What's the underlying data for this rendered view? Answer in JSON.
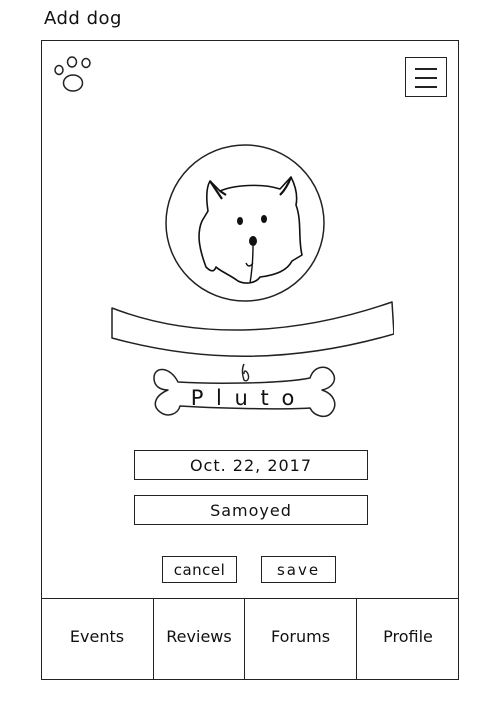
{
  "screen": {
    "title": "Add dog"
  },
  "header": {
    "logo_icon": "paw-print-icon",
    "menu_icon": "hamburger-menu-icon"
  },
  "profile": {
    "photo_icon": "dog-face-icon",
    "name": "Pluto",
    "name_display": "P l u t o",
    "birthdate": "Oct. 22, 2017",
    "breed": "Samoyed"
  },
  "actions": {
    "cancel_label": "cancel",
    "save_label": "save"
  },
  "nav": {
    "items": [
      {
        "label": "Events"
      },
      {
        "label": "Reviews"
      },
      {
        "label": "Forums"
      },
      {
        "label": "Profile"
      }
    ]
  },
  "colors": {
    "ink": "#222222",
    "background": "#ffffff"
  }
}
